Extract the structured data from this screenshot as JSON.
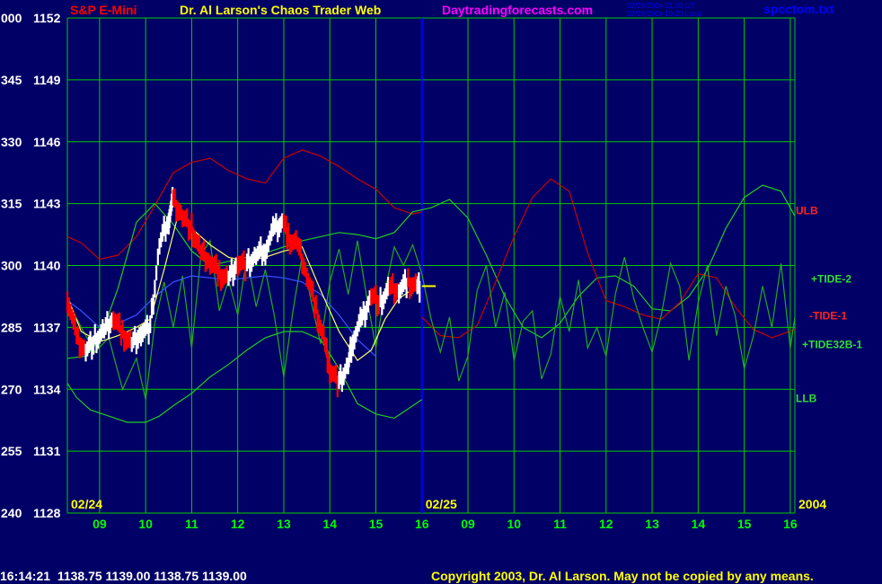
{
  "header": {
    "instrument": "S&P E-Mini",
    "site_title": "Dr. Al Larson's Chaos Trader Web",
    "site_url": "Daytradingforecasts.com",
    "timestamp_ut": "02/24/2004 21:20 UT",
    "timestamp_local": "02/24/2004 16:20 Local",
    "filename": "spcctom.txt"
  },
  "footer": {
    "quote": "16:14:21  1138.75 1139.00 1138.75 1139.00",
    "copyright": "Copyright 2003, Dr. Al Larson. May not be copied by any means."
  },
  "colors": {
    "background": "#000066",
    "grid": "#00cc00",
    "axis_labels": "#ffffff",
    "time_labels": "#00ff00",
    "instrument": "#ff0000",
    "site_title": "#ffff00",
    "site_url": "#ff00ff",
    "timestamps": "#0000ff",
    "filename": "#0000ff",
    "divider": "#0000ff",
    "price_up": "#ffffff",
    "price_down": "#ff0000",
    "ulb": "#cc0000",
    "tide2": "#22cc22",
    "tide1": "#cc0000",
    "tide32b": "#22aa22",
    "llb": "#22cc22",
    "avg_line": "#ffff66",
    "blue_trend": "#3355ff"
  },
  "chart_data": {
    "type": "line",
    "ylim": [
      1128,
      1152
    ],
    "y_ticks": [
      {
        "angle": "240",
        "price": "1128",
        "value": 1128
      },
      {
        "angle": "255",
        "price": "1131",
        "value": 1131
      },
      {
        "angle": "270",
        "price": "1134",
        "value": 1134
      },
      {
        "angle": "285",
        "price": "1137",
        "value": 1137
      },
      {
        "angle": "300",
        "price": "1140",
        "value": 1140
      },
      {
        "angle": "315",
        "price": "1143",
        "value": 1143
      },
      {
        "angle": "330",
        "price": "1146",
        "value": 1146
      },
      {
        "angle": "345",
        "price": "1149",
        "value": 1149
      },
      {
        "angle": "000",
        "price": "1152",
        "value": 1152
      }
    ],
    "xlim": [
      8.3,
      24.1
    ],
    "x_ticks": [
      {
        "label": "09",
        "x": 9
      },
      {
        "label": "10",
        "x": 10
      },
      {
        "label": "11",
        "x": 11
      },
      {
        "label": "12",
        "x": 12
      },
      {
        "label": "13",
        "x": 13
      },
      {
        "label": "14",
        "x": 14
      },
      {
        "label": "15",
        "x": 15
      },
      {
        "label": "16",
        "x": 16
      },
      {
        "label": "09",
        "x": 17
      },
      {
        "label": "10",
        "x": 18
      },
      {
        "label": "11",
        "x": 19
      },
      {
        "label": "12",
        "x": 20
      },
      {
        "label": "13",
        "x": 21
      },
      {
        "label": "14",
        "x": 22
      },
      {
        "label": "15",
        "x": 23
      },
      {
        "label": "16",
        "x": 24
      }
    ],
    "date_labels": [
      {
        "label": "02/24",
        "x": 8.3
      },
      {
        "label": "02/25",
        "x": 16.0
      },
      {
        "label": "2004",
        "x": 24.1
      }
    ],
    "day_divider_x": 16.0,
    "series": [
      {
        "name": "ULB",
        "color_key": "ulb",
        "label_y": 1142.7,
        "x": [
          8.3,
          8.6,
          9.0,
          9.4,
          9.8,
          10.2,
          10.6,
          11.0,
          11.4,
          11.8,
          12.2,
          12.6,
          13.0,
          13.4,
          13.8,
          14.2,
          14.6,
          15.0,
          15.4,
          15.8,
          16.0
        ],
        "y": [
          1141.4,
          1141.1,
          1140.3,
          1140.5,
          1141.4,
          1142.9,
          1144.5,
          1145.0,
          1145.2,
          1144.6,
          1144.2,
          1144.0,
          1145.2,
          1145.6,
          1145.3,
          1144.8,
          1144.2,
          1143.7,
          1142.8,
          1142.5,
          1142.6
        ]
      },
      {
        "name": "+TIDE-2",
        "color_key": "tide2",
        "label_y": 1139.4,
        "x": [
          8.3,
          8.7,
          9.0,
          9.4,
          9.8,
          10.2,
          10.6,
          11.0,
          11.4,
          11.8,
          12.2,
          12.6,
          13.0,
          13.4,
          13.8,
          14.2,
          14.6,
          15.0,
          15.4,
          15.8,
          16.2,
          16.6,
          17.0,
          17.4,
          17.8,
          18.2,
          18.6,
          19.0,
          19.4,
          19.8,
          20.2,
          20.6,
          21.0,
          21.4,
          21.8,
          22.2,
          22.6,
          23.0,
          23.4,
          23.8,
          24.1
        ],
        "y": [
          1135.5,
          1135.6,
          1136.4,
          1138.9,
          1142.1,
          1143.0,
          1142.0,
          1140.7,
          1140.0,
          1140.2,
          1140.4,
          1140.6,
          1140.9,
          1141.2,
          1141.4,
          1141.6,
          1141.5,
          1141.3,
          1141.6,
          1142.6,
          1142.8,
          1143.2,
          1142.3,
          1140.5,
          1138.5,
          1137.0,
          1136.5,
          1137.2,
          1138.5,
          1139.4,
          1139.5,
          1139.0,
          1137.9,
          1137.8,
          1138.5,
          1139.8,
          1141.8,
          1143.3,
          1143.9,
          1143.6,
          1142.4
        ]
      },
      {
        "name": "-TIDE-1",
        "color_key": "tide1",
        "label_y": 1137.6,
        "x": [
          16.0,
          16.4,
          16.8,
          17.2,
          17.6,
          18.0,
          18.4,
          18.8,
          19.2,
          19.6,
          20.0,
          20.4,
          20.8,
          21.2,
          21.6,
          22.0,
          22.4,
          22.8,
          23.2,
          23.6,
          24.1
        ],
        "y": [
          1137.5,
          1136.6,
          1136.5,
          1137.1,
          1139.2,
          1141.4,
          1143.3,
          1144.2,
          1143.6,
          1140.6,
          1138.3,
          1138.0,
          1137.6,
          1137.4,
          1138.2,
          1139.6,
          1139.4,
          1138.0,
          1136.9,
          1136.5,
          1136.9
        ]
      },
      {
        "name": "+TIDE32B-1",
        "color_key": "tide32b",
        "label_y": 1136.2,
        "x": [
          8.3,
          8.6,
          8.9,
          9.2,
          9.5,
          9.8,
          10.0,
          10.2,
          10.4,
          10.6,
          10.8,
          11.0,
          11.2,
          11.4,
          11.6,
          11.8,
          12.0,
          12.2,
          12.4,
          12.6,
          12.8,
          13.0,
          13.2,
          13.4,
          13.6,
          13.8,
          14.0,
          14.2,
          14.4,
          14.6,
          14.8,
          15.0,
          15.2,
          15.4,
          15.6,
          15.8,
          16.0,
          16.2,
          16.4,
          16.6,
          16.8,
          17.0,
          17.2,
          17.4,
          17.6,
          17.8,
          18.0,
          18.2,
          18.4,
          18.6,
          18.8,
          19.0,
          19.2,
          19.4,
          19.6,
          19.8,
          20.0,
          20.2,
          20.4,
          20.6,
          20.8,
          21.0,
          21.2,
          21.4,
          21.6,
          21.8,
          22.0,
          22.2,
          22.4,
          22.6,
          22.8,
          23.0,
          23.2,
          23.4,
          23.6,
          23.8,
          24.0,
          24.1
        ],
        "y": [
          1138.3,
          1137.0,
          1135.8,
          1136.5,
          1134.0,
          1135.5,
          1133.5,
          1137.2,
          1139.2,
          1137.0,
          1139.5,
          1136.0,
          1140.5,
          1141.2,
          1137.8,
          1139.3,
          1137.6,
          1140.4,
          1138.0,
          1139.8,
          1137.5,
          1134.6,
          1137.8,
          1140.5,
          1138.2,
          1136.2,
          1139.2,
          1140.8,
          1138.6,
          1141.2,
          1138.5,
          1136.0,
          1138.8,
          1140.9,
          1140.0,
          1141.0,
          1139.6,
          1137.4,
          1135.8,
          1137.5,
          1134.4,
          1135.6,
          1138.8,
          1140.0,
          1137.0,
          1138.7,
          1135.4,
          1137.3,
          1137.8,
          1134.5,
          1135.7,
          1138.5,
          1136.8,
          1139.3,
          1136.0,
          1137.0,
          1135.6,
          1138.6,
          1140.4,
          1138.4,
          1137.0,
          1135.8,
          1137.6,
          1140.1,
          1139.0,
          1135.4,
          1138.2,
          1140.0,
          1136.6,
          1139.0,
          1137.6,
          1135.0,
          1136.6,
          1139.0,
          1137.0,
          1140.1,
          1136.0,
          1137.5
        ]
      },
      {
        "name": "LLB",
        "color_key": "llb",
        "label_y": 1133.6,
        "x": [
          8.3,
          8.5,
          8.8,
          9.2,
          9.6,
          10.0,
          10.3,
          10.6,
          11.0,
          11.4,
          11.8,
          12.2,
          12.6,
          13.0,
          13.4,
          13.8,
          14.2,
          14.6,
          15.0,
          15.4,
          15.8,
          16.0
        ],
        "y": [
          1134.3,
          1133.6,
          1133.0,
          1132.7,
          1132.4,
          1132.4,
          1132.7,
          1133.2,
          1133.8,
          1134.6,
          1135.2,
          1135.9,
          1136.5,
          1136.8,
          1136.8,
          1136.4,
          1135.0,
          1133.3,
          1132.8,
          1132.6,
          1133.2,
          1133.5
        ]
      },
      {
        "name": "",
        "color_key": "blue_trend",
        "x": [
          8.3,
          8.6,
          9.0,
          9.4,
          9.8,
          10.2,
          10.6,
          11.0,
          11.4,
          11.8,
          12.2,
          12.6,
          13.0,
          13.4,
          13.8,
          14.2,
          14.6,
          15.0
        ],
        "y": [
          1138.3,
          1137.8,
          1137.0,
          1137.2,
          1137.6,
          1138.5,
          1139.2,
          1139.5,
          1139.4,
          1139.3,
          1139.4,
          1139.5,
          1139.4,
          1139.2,
          1138.6,
          1137.6,
          1136.4,
          1135.6
        ]
      },
      {
        "name": "",
        "color_key": "avg_line",
        "x": [
          8.3,
          8.6,
          9.0,
          9.4,
          9.8,
          10.1,
          10.4,
          10.7,
          11.0,
          11.4,
          11.8,
          12.2,
          12.6,
          13.0,
          13.4,
          13.8,
          14.2,
          14.6,
          14.9,
          15.2,
          15.5,
          15.7,
          15.9
        ],
        "y": [
          1138.5,
          1136.8,
          1136.3,
          1136.6,
          1137.0,
          1137.4,
          1139.8,
          1142.4,
          1141.8,
          1141.0,
          1140.4,
          1140.2,
          1140.4,
          1140.7,
          1140.9,
          1138.8,
          1136.8,
          1135.4,
          1135.9,
          1137.4,
          1138.4,
          1138.7,
          1138.9
        ]
      }
    ],
    "price_path": {
      "x": [
        8.3,
        8.5,
        8.7,
        8.9,
        9.1,
        9.3,
        9.5,
        9.7,
        9.9,
        10.1,
        10.3,
        10.5,
        10.6,
        10.8,
        11.0,
        11.2,
        11.4,
        11.6,
        11.8,
        12.0,
        12.2,
        12.4,
        12.6,
        12.8,
        13.0,
        13.1,
        13.3,
        13.5,
        13.7,
        13.9,
        14.0,
        14.2,
        14.4,
        14.5,
        14.7,
        14.9,
        15.1,
        15.3,
        15.5,
        15.7,
        15.9,
        16.0,
        16.3
      ],
      "y": [
        1138.5,
        1136.5,
        1135.9,
        1136.4,
        1136.8,
        1137.5,
        1136.7,
        1136.2,
        1136.8,
        1137.0,
        1141.0,
        1142.3,
        1143.2,
        1142.4,
        1141.8,
        1140.6,
        1140.2,
        1139.6,
        1139.4,
        1140.2,
        1140.0,
        1140.5,
        1140.8,
        1141.8,
        1142.2,
        1141.3,
        1141.0,
        1139.6,
        1137.9,
        1136.2,
        1135.0,
        1134.3,
        1135.2,
        1136.4,
        1137.4,
        1138.6,
        1138.2,
        1138.9,
        1138.8,
        1139.2,
        1139.0,
        1139.0,
        1139.0
      ]
    }
  }
}
